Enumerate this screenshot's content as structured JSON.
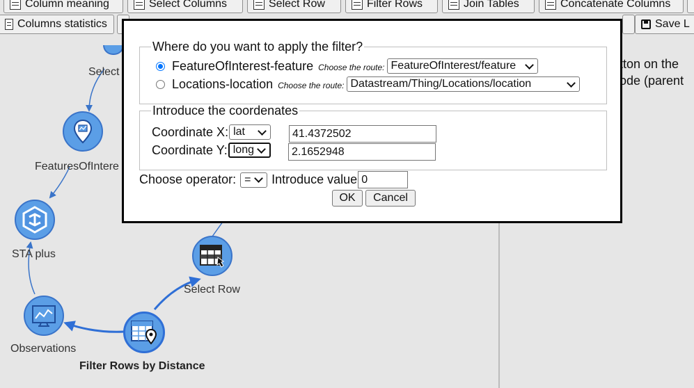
{
  "toolbar_row1": [
    "Column meaning",
    "Select Columns",
    "Select Row",
    "Filter Rows",
    "Join Tables",
    "Concatenate Columns"
  ],
  "toolbar_row2": {
    "columns_statistics": "Columns statistics",
    "save": "Save L"
  },
  "right_panel": {
    "line1": "tton on the",
    "line2": "ode (parent"
  },
  "graph": {
    "labels": {
      "select_top": "Select",
      "features": "FeaturesOfIntere",
      "sta_plus": "STA plus",
      "select_row": "Select Row",
      "observations": "Observations",
      "filter_rows": "Filter Rows by Distance"
    },
    "accent": "#2f6fd6",
    "node_fill": "#5b9ee6"
  },
  "dialog": {
    "title": "Where do you want to apply the filter?",
    "options": [
      {
        "label": "FeatureOfInterest-feature",
        "route_label": "Choose the route:",
        "route_value": "FeatureOfInterest/feature",
        "checked": true
      },
      {
        "label": "Locations-location",
        "route_label": "Choose the route:",
        "route_value": "Datastream/Thing/Locations/location",
        "checked": false
      }
    ],
    "coords": {
      "legend": "Introduce the coordenates",
      "x_label": "Coordinate X:",
      "x_select": "lat",
      "x_value": "41.4372502",
      "y_label": "Coordinate Y:",
      "y_select": "long",
      "y_value": "2.1652948"
    },
    "operator": {
      "label": "Choose operator:",
      "value": "=",
      "value_label": "Introduce value",
      "input": "0"
    },
    "ok": "OK",
    "cancel": "Cancel"
  }
}
